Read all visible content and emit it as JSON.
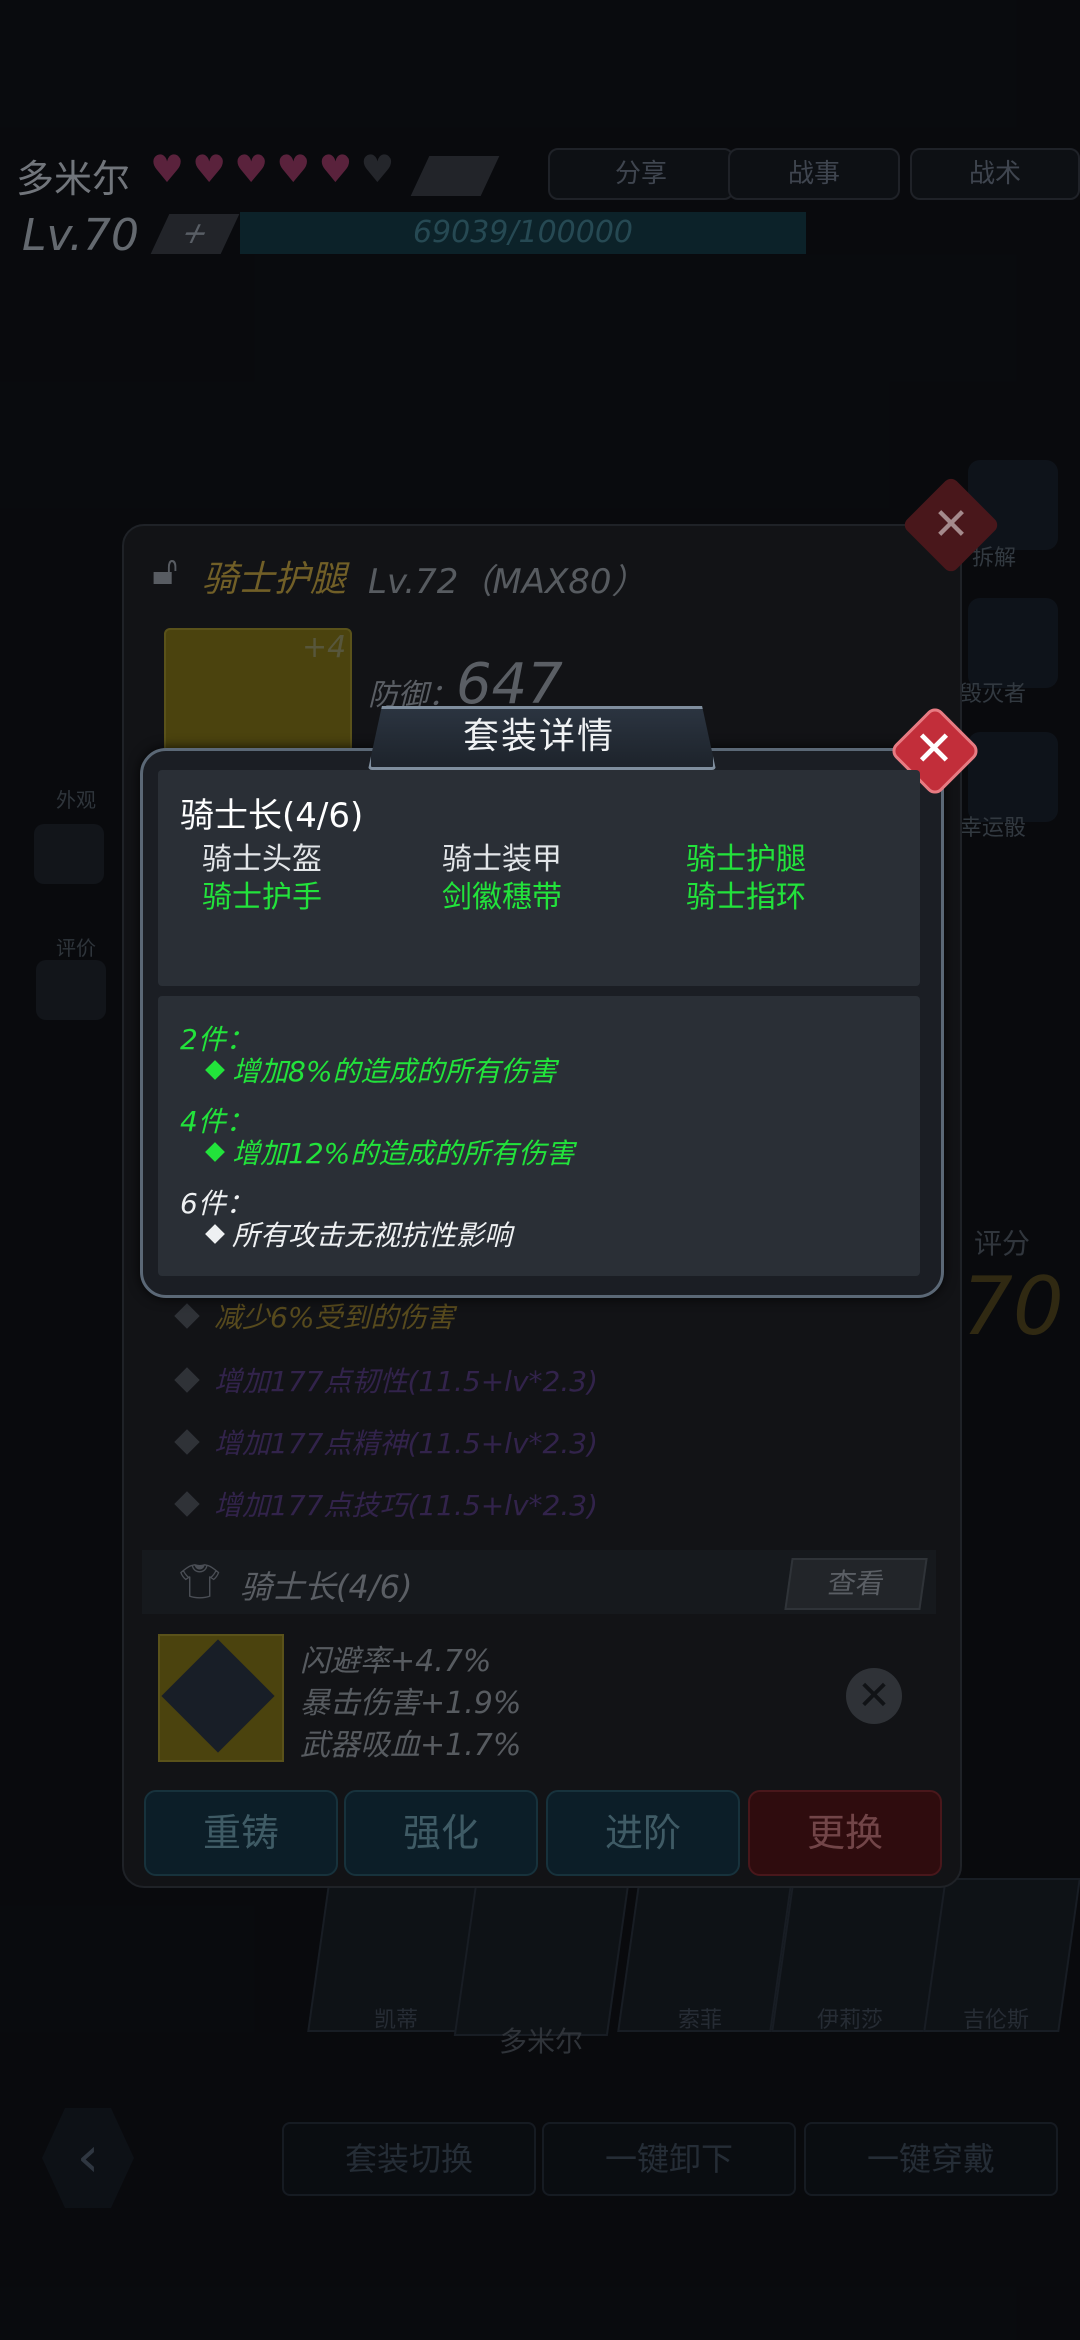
{
  "background": {
    "character_name": "多米尔",
    "level_text": "Lv.70",
    "exp_text": "69039/100000",
    "top_buttons": [
      "分享",
      "战事",
      "战术"
    ],
    "score_label": "评分",
    "score_value": "70",
    "right_side": [
      "拆解",
      "毁灭者",
      "幸运骰"
    ],
    "left_side": [
      "外观",
      "评价"
    ],
    "portraits": [
      "凯蒂",
      "多米尔",
      "索菲",
      "伊莉莎",
      "吉伦斯"
    ],
    "bottom_buttons": [
      "套装切换",
      "一键卸下",
      "一键穿戴"
    ]
  },
  "equipment_panel": {
    "name": "骑士护腿",
    "level": "Lv.72（MAX80）",
    "enhance": "+4",
    "defense_label": "防御：",
    "defense_value": "647",
    "stats": [
      {
        "text": "减少6%受到的伤害"
      },
      {
        "text": "增加177点韧性(11.5+lv*2.3)"
      },
      {
        "text": "增加177点精神(11.5+lv*2.3)"
      },
      {
        "text": "增加177点技巧(11.5+lv*2.3)"
      }
    ],
    "set_strip_name": "骑士长(4/6)",
    "view_button": "查看",
    "gem_stats": [
      "闪避率+4.7%",
      "暴击伤害+1.9%",
      "武器吸血+1.7%"
    ],
    "actions": {
      "recast": "重铸",
      "enhance": "强化",
      "advance": "进阶",
      "replace": "更换"
    }
  },
  "modal": {
    "title": "套装详情",
    "set_name": "骑士长(4/6)",
    "pieces": [
      {
        "name": "骑士头盔",
        "equipped": false
      },
      {
        "name": "骑士装甲",
        "equipped": false
      },
      {
        "name": "骑士护腿",
        "equipped": true
      },
      {
        "name": "骑士护手",
        "equipped": true
      },
      {
        "name": "剑徽穗带",
        "equipped": true
      },
      {
        "name": "骑士指环",
        "equipped": true
      }
    ],
    "bonuses": [
      {
        "head": "2件：",
        "text": "增加8%的造成的所有伤害",
        "active": true
      },
      {
        "head": "4件：",
        "text": "增加12%的造成的所有伤害",
        "active": true
      },
      {
        "head": "6件：",
        "text": "所有攻击无视抗性影响",
        "active": false
      }
    ]
  },
  "colors": {
    "active_green": "#22e33b",
    "close_red": "#c22e3a",
    "inactive_white": "#eef0f2"
  }
}
